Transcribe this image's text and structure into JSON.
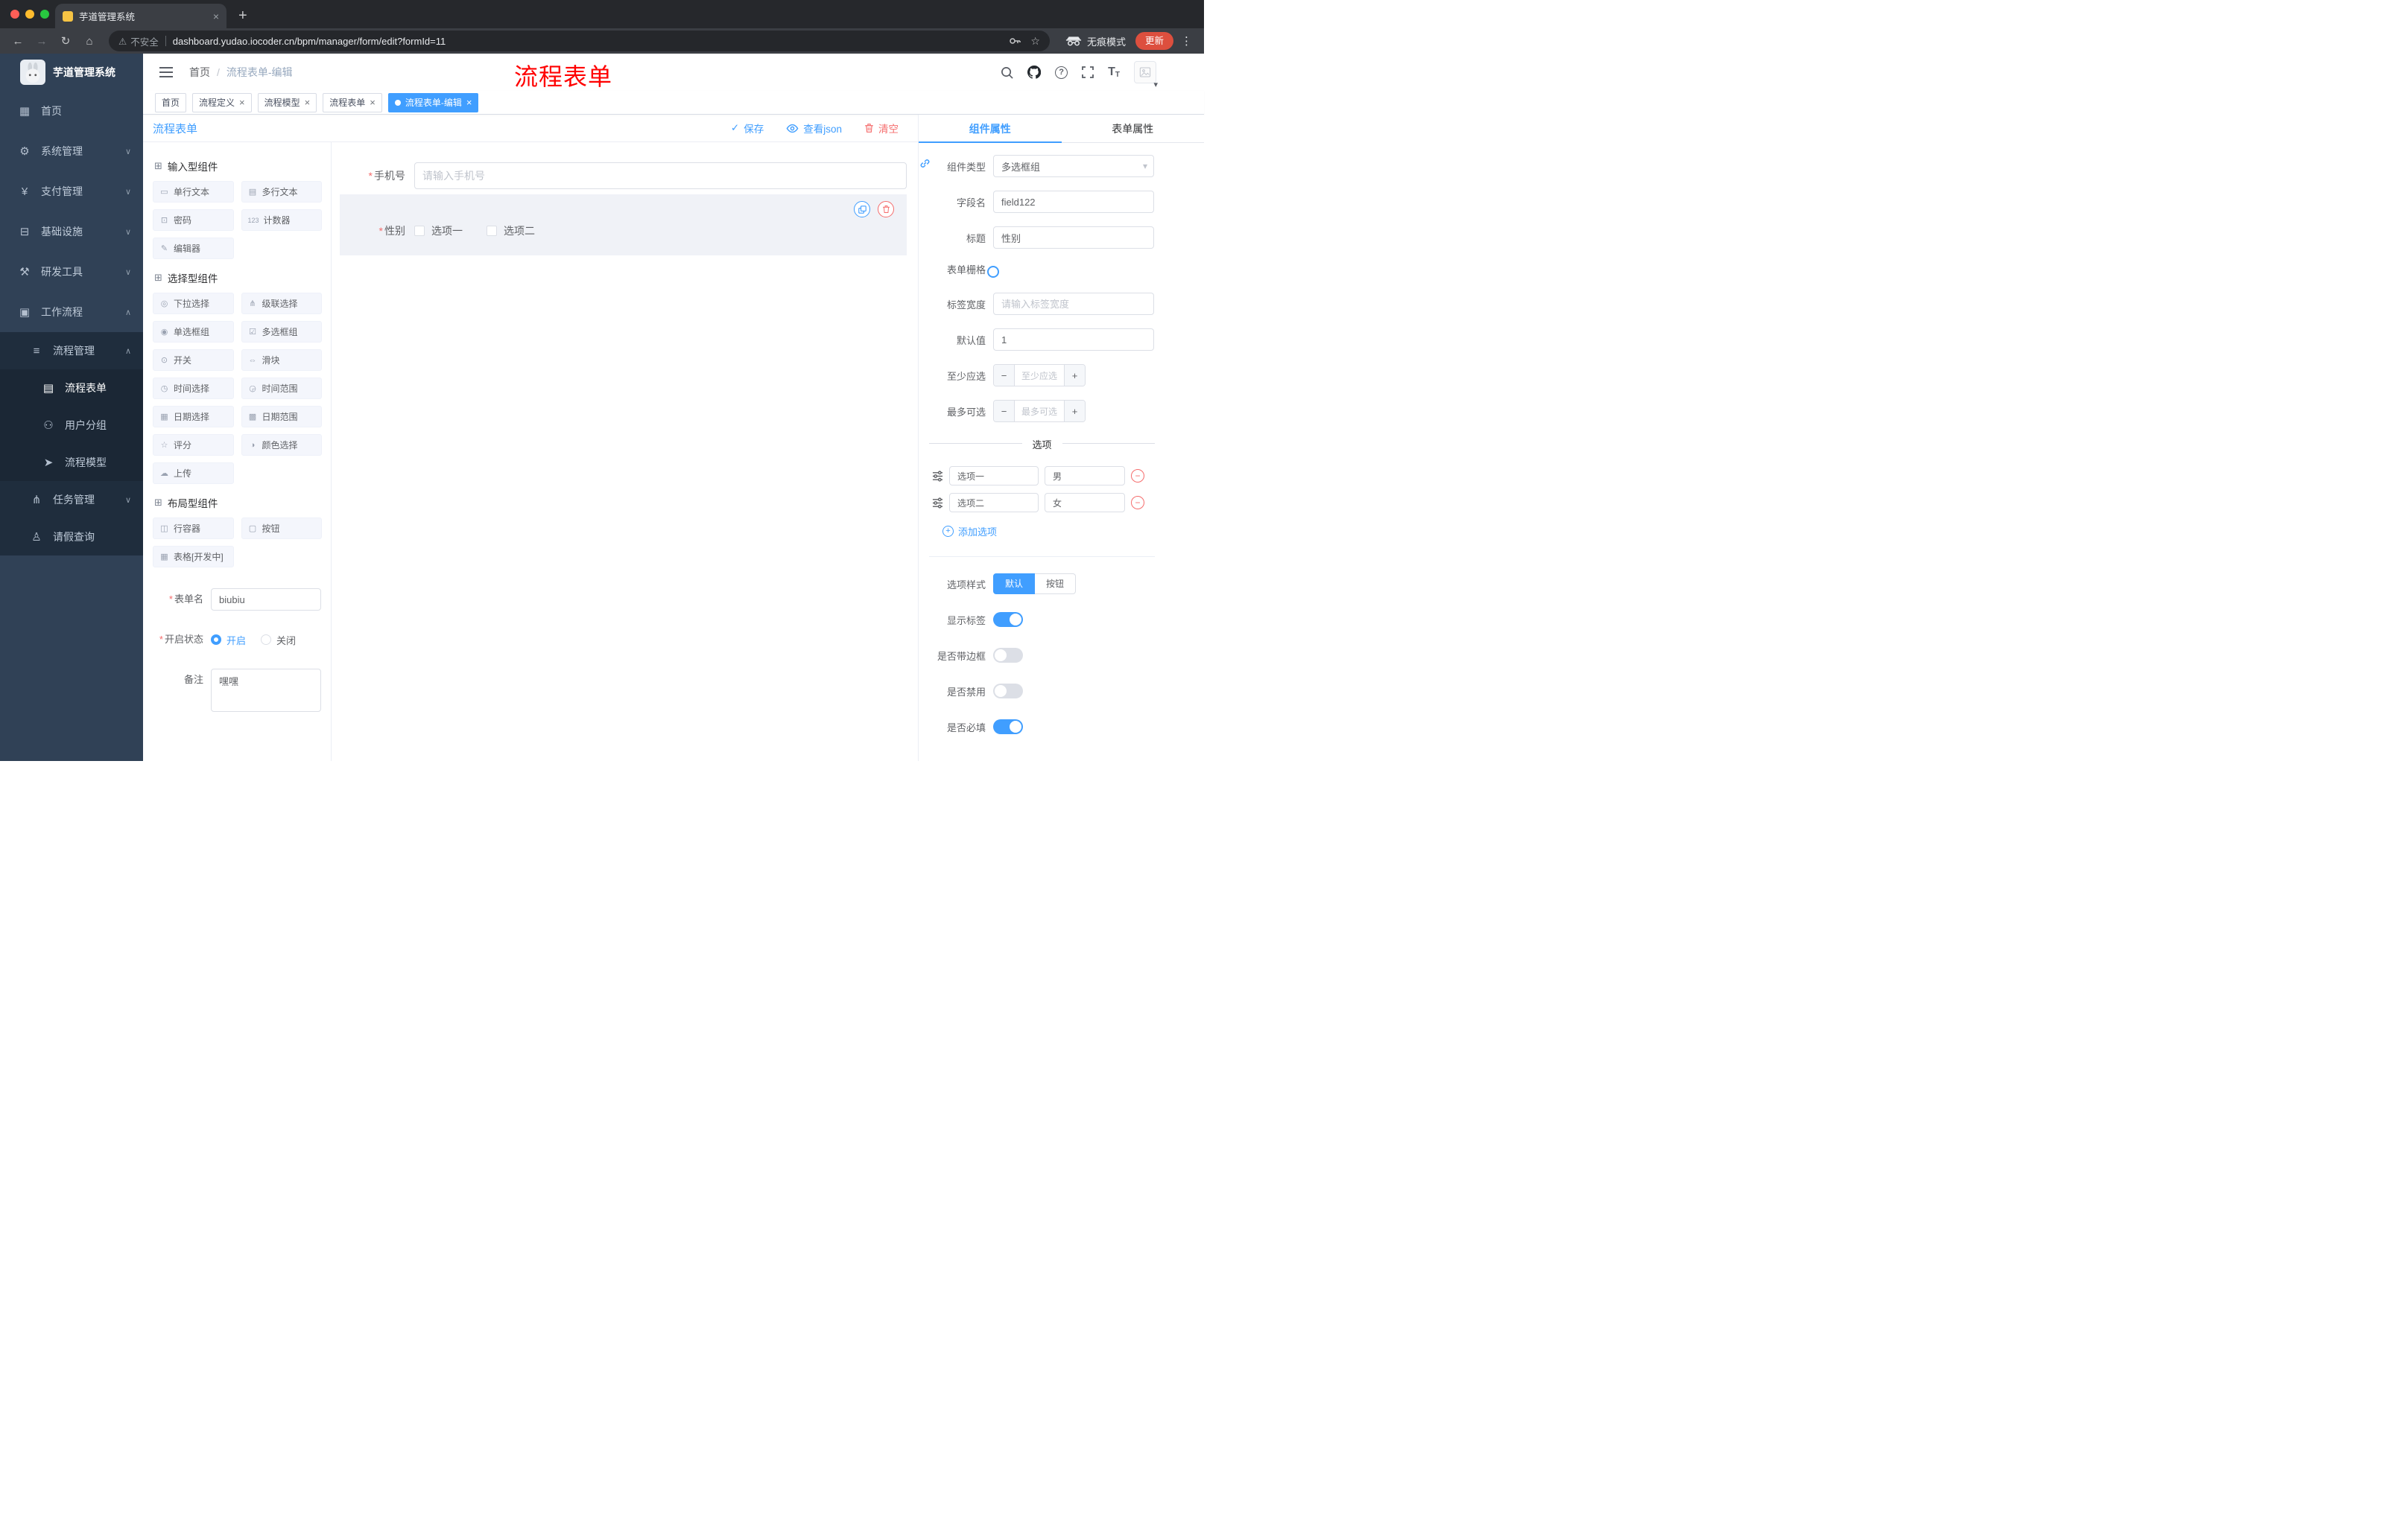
{
  "icons": {
    "back": "←",
    "forward": "→",
    "reload": "↻",
    "home": "⌂",
    "warning": "⚠",
    "star": "☆",
    "kebab": "⋮",
    "caret": "▾",
    "check": "✓",
    "close": "×",
    "new_tab": "+",
    "question": "?",
    "font_large": "T",
    "font_small": "T",
    "dropdown": "▾",
    "asterisk": "*",
    "minus": "−",
    "plus": "+",
    "add": "+",
    "remove": "−"
  },
  "colors": {
    "accent": "#409eff",
    "danger": "#f56c6c",
    "annotation": "#ff0000",
    "update_badge": "#dd4f3e"
  },
  "browser": {
    "tab_title": "芋道管理系统",
    "security": "不安全",
    "url": "dashboard.yudao.iocoder.cn/bpm/manager/form/edit?formId=11",
    "incognito": "无痕模式",
    "update": "更新"
  },
  "sidebar": {
    "title": "芋道管理系统",
    "items": [
      {
        "label": "首页",
        "icon": "▦"
      },
      {
        "label": "系统管理",
        "icon": "⚙",
        "arrow": "∨"
      },
      {
        "label": "支付管理",
        "icon": "¥",
        "arrow": "∨"
      },
      {
        "label": "基础设施",
        "icon": "⊟",
        "arrow": "∨"
      },
      {
        "label": "研发工具",
        "icon": "⚒",
        "arrow": "∨"
      },
      {
        "label": "工作流程",
        "icon": "▣",
        "arrow": "∧"
      },
      {
        "label": "流程管理",
        "icon": "≡",
        "arrow": "∧"
      },
      {
        "label": "流程表单",
        "icon": "▤"
      },
      {
        "label": "用户分组",
        "icon": "⚇"
      },
      {
        "label": "流程模型",
        "icon": "➤"
      },
      {
        "label": "任务管理",
        "icon": "⋔",
        "arrow": "∨"
      },
      {
        "label": "请假查询",
        "icon": "♙"
      }
    ]
  },
  "header": {
    "crumb_home": "首页",
    "crumb_sep": "/",
    "crumb_current": "流程表单-编辑",
    "annotation": "流程表单"
  },
  "tags": [
    {
      "label": "首页"
    },
    {
      "label": "流程定义"
    },
    {
      "label": "流程模型"
    },
    {
      "label": "流程表单"
    },
    {
      "label": "流程表单-编辑"
    }
  ],
  "designer": {
    "panel_title": "流程表单",
    "save": "保存",
    "view_json": "查看json",
    "clear": "清空",
    "groups": [
      {
        "title": "输入型组件",
        "icon": "⊞",
        "items": [
          {
            "label": "单行文本",
            "icon": "▭"
          },
          {
            "label": "多行文本",
            "icon": "▤"
          },
          {
            "label": "密码",
            "icon": "⊡"
          },
          {
            "label": "计数器",
            "icon": "123"
          },
          {
            "label": "编辑器",
            "icon": "✎"
          }
        ]
      },
      {
        "title": "选择型组件",
        "icon": "⊞",
        "items": [
          {
            "label": "下拉选择",
            "icon": "◎"
          },
          {
            "label": "级联选择",
            "icon": "⋔"
          },
          {
            "label": "单选框组",
            "icon": "◉"
          },
          {
            "label": "多选框组",
            "icon": "☑"
          },
          {
            "label": "开关",
            "icon": "⊙"
          },
          {
            "label": "滑块",
            "icon": "⇔"
          },
          {
            "label": "时间选择",
            "icon": "◷"
          },
          {
            "label": "时间范围",
            "icon": "◶"
          },
          {
            "label": "日期选择",
            "icon": "▦"
          },
          {
            "label": "日期范围",
            "icon": "▩"
          },
          {
            "label": "评分",
            "icon": "☆"
          },
          {
            "label": "颜色选择",
            "icon": "◑"
          },
          {
            "label": "上传",
            "icon": "☁"
          }
        ]
      },
      {
        "title": "布局型组件",
        "icon": "⊞",
        "items": [
          {
            "label": "行容器",
            "icon": "◫"
          },
          {
            "label": "按钮",
            "icon": "▢"
          },
          {
            "label": "表格[开发中]",
            "icon": "▦"
          }
        ]
      }
    ],
    "meta": {
      "name_label": "表单名",
      "name_value": "biubiu",
      "status_label": "开启状态",
      "status_on": "开启",
      "status_off": "关闭",
      "remark_label": "备注",
      "remark_value": "嘿嘿"
    },
    "canvas": {
      "phone_label": "手机号",
      "phone_placeholder": "请输入手机号",
      "gender_label": "性别",
      "opt1": "选项一",
      "opt2": "选项二"
    }
  },
  "properties": {
    "tab_component": "组件属性",
    "tab_form": "表单属性",
    "type_label": "组件类型",
    "type_value": "多选框组",
    "field_label": "字段名",
    "field_value": "field122",
    "title_label": "标题",
    "title_value": "性别",
    "grid_label": "表单栅格",
    "width_label": "标签宽度",
    "width_placeholder": "请输入标签宽度",
    "default_label": "默认值",
    "default_value": "1",
    "min_label": "至少应选",
    "min_placeholder": "至少应选",
    "max_label": "最多可选",
    "max_placeholder": "最多可选",
    "options_divider": "选项",
    "opt1_text": "选项一",
    "opt1_value": "男",
    "opt2_text": "选项二",
    "opt2_value": "女",
    "add_option": "添加选项",
    "style_label": "选项样式",
    "style_default": "默认",
    "style_button": "按钮",
    "switches": {
      "show": {
        "label": "显示标签",
        "on": true
      },
      "border": {
        "label": "是否带边框",
        "on": false
      },
      "disabled": {
        "label": "是否禁用",
        "on": false
      },
      "required": {
        "label": "是否必填",
        "on": true
      }
    }
  }
}
